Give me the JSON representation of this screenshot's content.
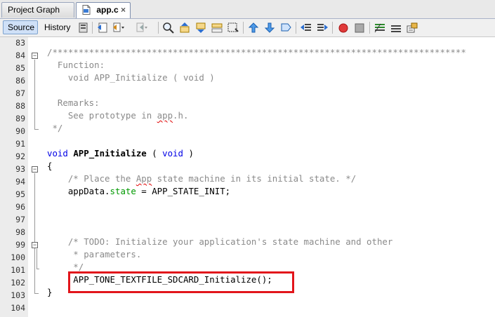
{
  "tabs": [
    {
      "label": "Project Graph",
      "active": false
    },
    {
      "label": "app.c",
      "active": true,
      "close": "×"
    }
  ],
  "toolbar": {
    "source_label": "Source",
    "history_label": "History"
  },
  "lines": [
    {
      "n": "83"
    },
    {
      "n": "84"
    },
    {
      "n": "85"
    },
    {
      "n": "86"
    },
    {
      "n": "87"
    },
    {
      "n": "88"
    },
    {
      "n": "89"
    },
    {
      "n": "90"
    },
    {
      "n": "91"
    },
    {
      "n": "92"
    },
    {
      "n": "93"
    },
    {
      "n": "94"
    },
    {
      "n": "95"
    },
    {
      "n": "96"
    },
    {
      "n": "97"
    },
    {
      "n": "98"
    },
    {
      "n": "99"
    },
    {
      "n": "100"
    },
    {
      "n": "101"
    },
    {
      "n": "102"
    },
    {
      "n": "103"
    },
    {
      "n": "104"
    }
  ],
  "code": {
    "l84": "/*******************************************************************************",
    "l85": "  Function:",
    "l86": "    void APP_Initialize ( void )",
    "l88": "  Remarks:",
    "l89a": "    See prototype in ",
    "l89b": "app",
    "l89c": ".h.",
    "l90": " */",
    "l92_kw1": "void",
    "l92_fn": "APP_Initialize",
    "l92_mid": " ( ",
    "l92_kw2": "void",
    "l92_end": " )",
    "l93": "{",
    "l94a": "    /* Place the ",
    "l94b": "App",
    "l94c": " state machine in its initial state. */",
    "l95a": "    appData.",
    "l95b": "state",
    "l95c": " = APP_STATE_INIT;",
    "l99": "    /* TODO: Initialize your application's state machine and other",
    "l100": "     * parameters.",
    "l101": "     */",
    "l102": "     APP_TONE_TEXTFILE_SDCARD_Initialize();",
    "l103": "}"
  },
  "colors": {
    "highlight_border": "#e2151b",
    "keyword": "#0000e6",
    "comment": "#8a8a8a",
    "field": "#009900"
  }
}
